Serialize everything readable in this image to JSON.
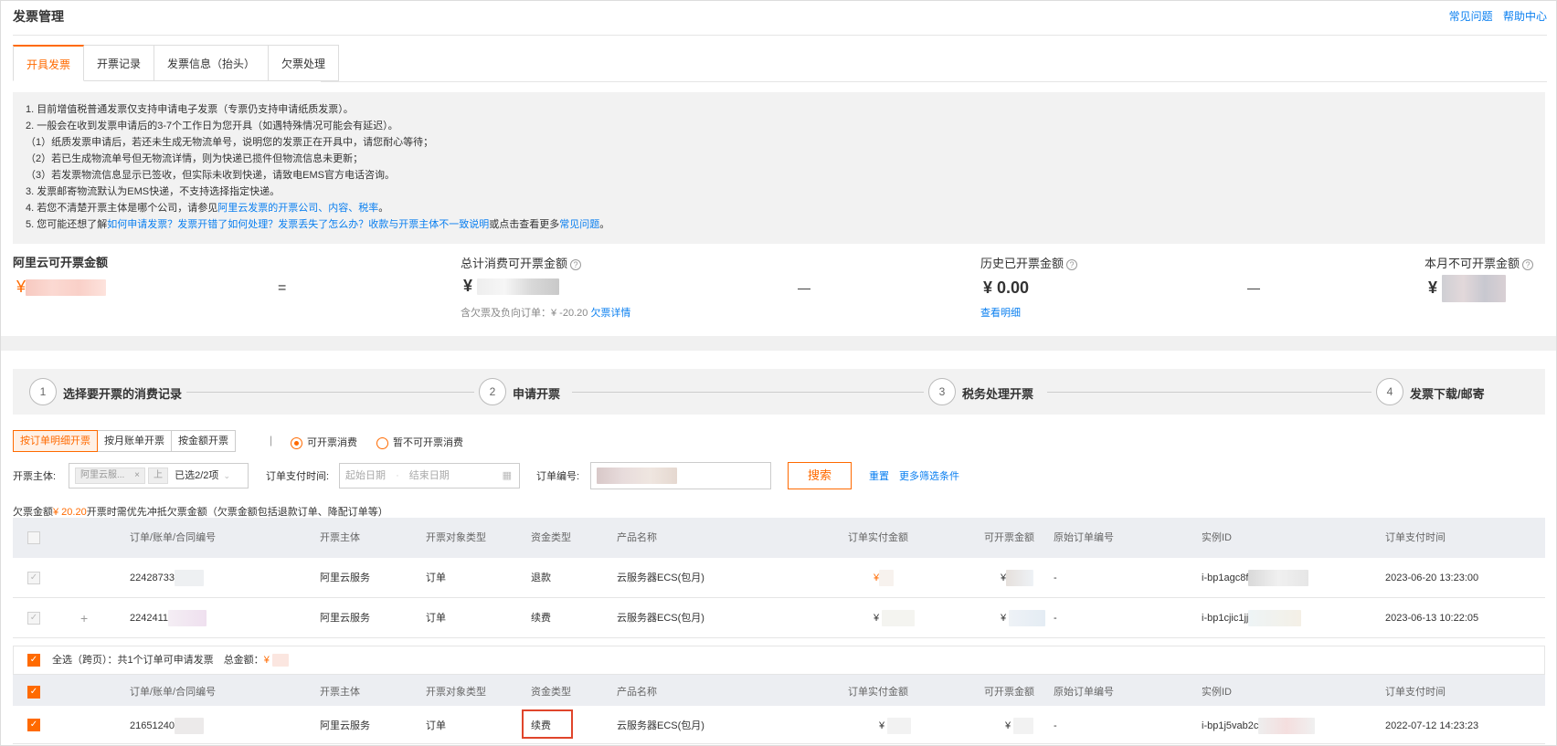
{
  "header": {
    "title": "发票管理",
    "links": [
      "常见问题",
      "帮助中心"
    ]
  },
  "tabs": [
    "开具发票",
    "开票记录",
    "发票信息（抬头）",
    "欠票处理"
  ],
  "notice": {
    "lines": [
      "1. 目前增值税普通发票仅支持申请电子发票（专票仍支持申请纸质发票）。",
      "2. 一般会在收到发票申请后的3-7个工作日为您开具（如遇特殊情况可能会有延迟）。",
      "（1）纸质发票申请后，若还未生成无物流单号，说明您的发票正在开具中，请您耐心等待；",
      "（2）若已生成物流单号但无物流详情，则为快递已揽件但物流信息未更新；",
      "（3）若发票物流信息显示已签收，但实际未收到快递，请致电EMS官方电话咨询。",
      "3. 发票邮寄物流默认为EMS快递，不支持选择指定快递。"
    ],
    "line4_prefix": "4. 若您不清楚开票主体是哪个公司，请参见",
    "line4_link": "阿里云发票的开票公司、内容、税率",
    "line4_suffix": "。",
    "line5_prefix": "5. 您可能还想了解",
    "line5_link": "如何申请发票？发票开错了如何处理？发票丢失了怎么办？收款与开票主体不一致说明",
    "line5_mid": "或点击查看更多",
    "line5_link2": "常见问题",
    "line5_suffix": "。"
  },
  "summary": {
    "available_label": "阿里云可开票金额",
    "currency": "¥",
    "eq": "=",
    "minus": "—",
    "total_label": "总计消费可开票金额",
    "total_note_prefix": "含欠票及负向订单：",
    "total_note_value": "¥ -20.20",
    "total_note_link": "欠票详情",
    "history_label": "历史已开票金额",
    "history_value": "¥ 0.00",
    "history_link": "查看明细",
    "month_label": "本月不可开票金额"
  },
  "steps": [
    {
      "num": "1",
      "label": "选择要开票的消费记录"
    },
    {
      "num": "2",
      "label": "申请开票"
    },
    {
      "num": "3",
      "label": "税务处理开票"
    },
    {
      "num": "4",
      "label": "发票下载/邮寄"
    }
  ],
  "modes": [
    "按订单明细开票",
    "按月账单开票",
    "按金额开票"
  ],
  "divider": "|",
  "radios": [
    {
      "label": "可开票消费",
      "checked": true
    },
    {
      "label": "暂不可开票消费",
      "checked": false
    }
  ],
  "filters": {
    "entity_label": "开票主体:",
    "entity_tag": "阿里云服...",
    "entity_tag_close": "×",
    "entity_tag_extra": "上",
    "entity_count": "已选2/2项",
    "pay_time_label": "订单支付时间:",
    "start_placeholder": "起始日期",
    "end_placeholder": "结束日期",
    "order_no_label": "订单编号:",
    "search_button": "搜索",
    "reset": "重置",
    "more_filters": "更多筛选条件"
  },
  "owe_note": {
    "prefix": "欠票金额",
    "amount": "¥ 20.20",
    "suffix": "开票时需优先冲抵欠票金额（欠票金额包括退款订单、降配订单等）"
  },
  "columns": [
    "订单/账单/合同编号",
    "开票主体",
    "开票对象类型",
    "资金类型",
    "产品名称",
    "订单实付金额",
    "可开票金额",
    "原始订单编号",
    "实例ID",
    "订单支付时间"
  ],
  "rows_top": [
    {
      "order": "22428733",
      "expand": "",
      "entity": "阿里云服务",
      "obj": "订单",
      "fund": "退款",
      "product": "云服务器ECS(包月)",
      "paid": "¥",
      "avail": "¥",
      "orig": "-",
      "instance": "i-bp1agc8f",
      "time": "2023-06-20 13:23:00"
    },
    {
      "order": "2242411",
      "expand": "+",
      "entity": "阿里云服务",
      "obj": "订单",
      "fund": "续费",
      "product": "云服务器ECS(包月)",
      "paid": "¥",
      "avail": "¥",
      "orig": "-",
      "instance": "i-bp1cjic1jj",
      "time": "2023-06-13 10:22:05"
    }
  ],
  "select_bar": {
    "label": "全选（跨页）：共1个订单可申请发票",
    "total_label": "总金额：",
    "total_currency": "¥"
  },
  "rows_bottom": [
    {
      "order": "21651240",
      "entity": "阿里云服务",
      "obj": "订单",
      "fund": "续费",
      "product": "云服务器ECS(包月)",
      "paid": "¥",
      "avail": "¥",
      "orig": "-",
      "instance": "i-bp1j5vab2c",
      "time": "2022-07-12 14:23:23"
    }
  ],
  "colors": {
    "accent": "#ff6a00",
    "link": "#0a7ff0",
    "highlight": "#e0452b"
  }
}
